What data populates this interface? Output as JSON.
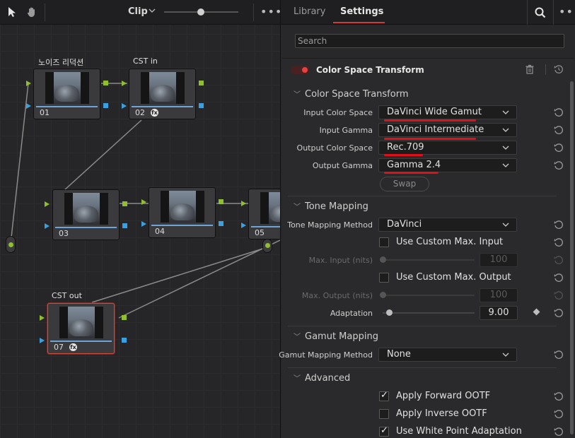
{
  "toolbar": {
    "clip_label": "Clip",
    "tools": [
      "pointer-icon",
      "hand-icon"
    ]
  },
  "nodes": [
    {
      "id": "01",
      "title": "노이즈 리덕션",
      "fx": false,
      "selected": false
    },
    {
      "id": "02",
      "title": "CST in",
      "fx": true,
      "selected": false
    },
    {
      "id": "03",
      "title": "",
      "fx": false,
      "selected": false
    },
    {
      "id": "04",
      "title": "",
      "fx": false,
      "selected": false
    },
    {
      "id": "05",
      "title": "",
      "fx": false,
      "selected": false
    },
    {
      "id": "07",
      "title": "CST out",
      "fx": true,
      "selected": true
    }
  ],
  "panel": {
    "tabs": [
      {
        "label": "Library",
        "active": false
      },
      {
        "label": "Settings",
        "active": true
      }
    ],
    "search_placeholder": "Search",
    "effect_title": "Color Space Transform",
    "sections": {
      "cst": "Color Space Transform",
      "tone": "Tone Mapping",
      "gamut": "Gamut Mapping",
      "advanced": "Advanced"
    },
    "fields": {
      "input_color_space": {
        "label": "Input Color Space",
        "value": "DaVinci Wide Gamut"
      },
      "input_gamma": {
        "label": "Input Gamma",
        "value": "DaVinci Intermediate"
      },
      "output_color_space": {
        "label": "Output Color Space",
        "value": "Rec.709"
      },
      "output_gamma": {
        "label": "Output Gamma",
        "value": "Gamma 2.4"
      },
      "swap": "Swap",
      "tone_mapping_method": {
        "label": "Tone Mapping Method",
        "value": "DaVinci"
      },
      "use_custom_max_input": {
        "label": "Use Custom Max. Input",
        "checked": false
      },
      "max_input": {
        "label": "Max. Input (nits)",
        "value": "100",
        "enabled": false
      },
      "use_custom_max_output": {
        "label": "Use Custom Max. Output",
        "checked": false
      },
      "max_output": {
        "label": "Max. Output (nits)",
        "value": "100",
        "enabled": false
      },
      "adaptation": {
        "label": "Adaptation",
        "value": "9.00",
        "level": 0.0
      },
      "gamut_mapping_method": {
        "label": "Gamut Mapping Method",
        "value": "None"
      },
      "apply_forward_ootf": {
        "label": "Apply Forward OOTF",
        "checked": true
      },
      "apply_inverse_ootf": {
        "label": "Apply Inverse OOTF",
        "checked": false
      },
      "use_white_point_adaptation": {
        "label": "Use White Point Adaptation",
        "checked": true
      }
    }
  },
  "colors": {
    "accent_red": "#d03a3a",
    "annotation_red": "#e0101a",
    "port_green": "#8fbf2c",
    "port_blue": "#3aa0e0"
  }
}
